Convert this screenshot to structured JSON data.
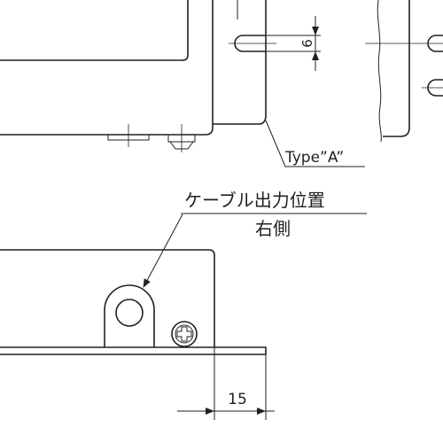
{
  "labels": {
    "slot_dimension": "6",
    "type_callout": "Type”A”",
    "cable_position_line1": "ケーブル出力位置",
    "cable_position_line2": "右側",
    "offset_dimension": "15"
  }
}
